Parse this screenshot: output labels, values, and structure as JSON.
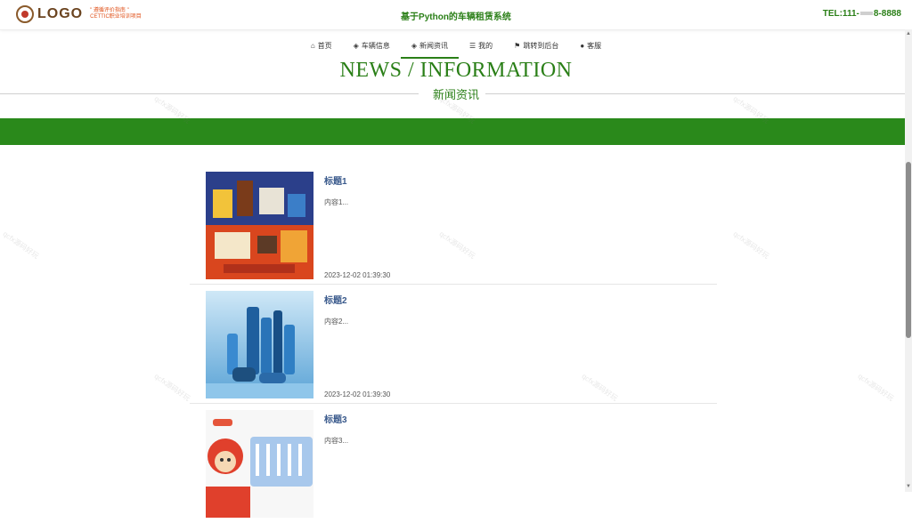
{
  "header": {
    "logo_text": "LOGO",
    "logo_sub_line1": "\" 遵循评价指南 \"",
    "logo_sub_line2": "CETTIC职业培训项目",
    "site_title": "基于Python的车辆租赁系统",
    "tel_prefix": "TEL:111-",
    "tel_suffix": "8-8888"
  },
  "nav": {
    "items": [
      {
        "label": "首页",
        "icon": "home-icon"
      },
      {
        "label": "车辆信息",
        "icon": "layers-icon"
      },
      {
        "label": "新闻资讯",
        "icon": "layers-icon",
        "active": true
      },
      {
        "label": "我的",
        "icon": "list-icon"
      },
      {
        "label": "跳转到后台",
        "icon": "flag-icon"
      },
      {
        "label": "客服",
        "icon": "chat-icon"
      }
    ]
  },
  "section": {
    "title_en": "NEWS / INFORMATION",
    "title_cn": "新闻资讯"
  },
  "news": [
    {
      "title": "标题1",
      "content": "内容1...",
      "date": "2023-12-02 01:39:30"
    },
    {
      "title": "标题2",
      "content": "内容2...",
      "date": "2023-12-02 01:39:30"
    },
    {
      "title": "标题3",
      "content": "内容3...",
      "date": ""
    }
  ],
  "watermark_text": "qcfx源码好玩",
  "colors": {
    "accent": "#2a7f17",
    "banner": "#2a891b",
    "title_link": "#3a5a8c"
  }
}
